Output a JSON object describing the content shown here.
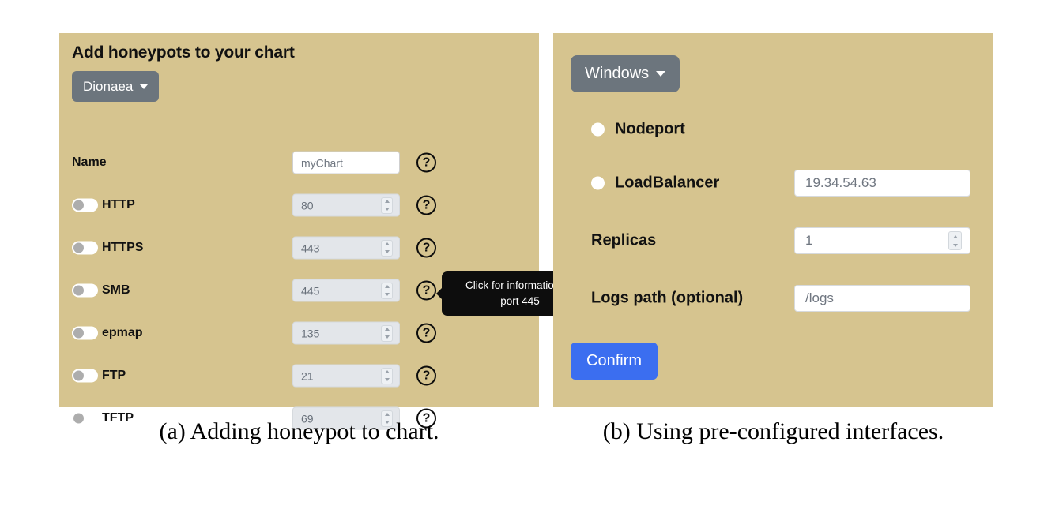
{
  "panel_a": {
    "title": "Add honeypots to your chart",
    "dropdown": {
      "label": "Dionaea",
      "caret_icon": "caret-down-icon"
    },
    "help_icon_glyph": "?",
    "name_row": {
      "label": "Name",
      "value": "myChart",
      "help": "?"
    },
    "ports": [
      {
        "label": "HTTP",
        "value": "80",
        "toggle": "off",
        "help": "?"
      },
      {
        "label": "HTTPS",
        "value": "443",
        "toggle": "off",
        "help": "?"
      },
      {
        "label": "SMB",
        "value": "445",
        "toggle": "off",
        "help": "?"
      },
      {
        "label": "epmap",
        "value": "135",
        "toggle": "off",
        "help": "?"
      },
      {
        "label": "FTP",
        "value": "21",
        "toggle": "off",
        "help": "?"
      },
      {
        "label": "TFTP",
        "value": "69",
        "toggle": "off",
        "help": "?"
      }
    ],
    "tooltip": {
      "line1": "Click for information on",
      "line2": "port 445"
    }
  },
  "panel_b": {
    "dropdown": {
      "label": "Windows",
      "caret_icon": "caret-down-icon"
    },
    "nodeport": {
      "label": "Nodeport",
      "selected": false
    },
    "loadbalancer": {
      "label": "LoadBalancer",
      "selected": false,
      "value": "19.34.54.63"
    },
    "replicas": {
      "label": "Replicas",
      "value": "1"
    },
    "logs_path": {
      "label": "Logs path (optional)",
      "value": "/logs"
    },
    "confirm": {
      "label": "Confirm"
    }
  },
  "captions": {
    "a": "(a) Adding honeypot to chart.",
    "b": "(b) Using pre-configured interfaces."
  },
  "colors": {
    "panel_bg": "#d6c48f",
    "dropdown_bg": "#6c757d",
    "confirm_bg": "#3b6ef0",
    "tooltip_bg": "#0d0d0d",
    "page_bg": "#ffffff"
  }
}
